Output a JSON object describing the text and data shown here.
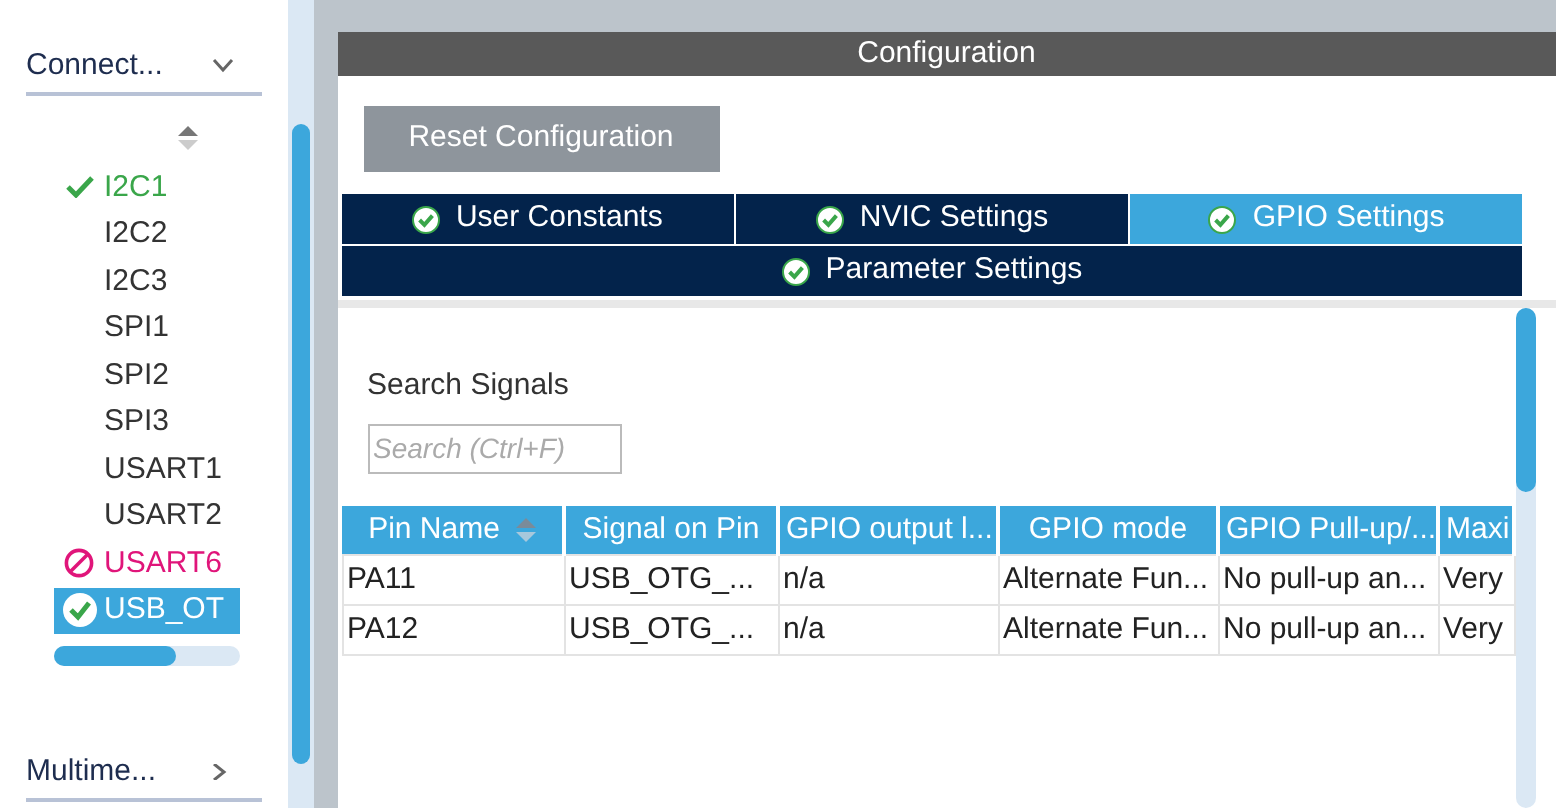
{
  "sidebar": {
    "category": {
      "label": "Connect...",
      "expanded": true
    },
    "items": [
      {
        "label": "I2C1",
        "kind": "configured",
        "selected": false
      },
      {
        "label": "I2C2",
        "kind": "plain",
        "selected": false
      },
      {
        "label": "I2C3",
        "kind": "plain",
        "selected": false
      },
      {
        "label": "SPI1",
        "kind": "plain",
        "selected": false
      },
      {
        "label": "SPI2",
        "kind": "plain",
        "selected": false
      },
      {
        "label": "SPI3",
        "kind": "plain",
        "selected": false
      },
      {
        "label": "USART1",
        "kind": "plain",
        "selected": false
      },
      {
        "label": "USART2",
        "kind": "plain",
        "selected": false
      },
      {
        "label": "USART6",
        "kind": "disabled",
        "selected": false
      },
      {
        "label": "USB_OT",
        "kind": "configured",
        "selected": true
      }
    ],
    "next_category": {
      "label": "Multime...",
      "expanded": false
    }
  },
  "panel": {
    "title": "Configuration",
    "reset_button": "Reset Configuration",
    "tabs": [
      {
        "label": "User Constants",
        "selected": false
      },
      {
        "label": "NVIC Settings",
        "selected": false
      },
      {
        "label": "GPIO Settings",
        "selected": true
      },
      {
        "label": "Parameter Settings",
        "selected": false
      }
    ],
    "search": {
      "label": "Search Signals",
      "placeholder": "Search (Ctrl+F)"
    },
    "table": {
      "columns": [
        "Pin Name",
        "Signal on Pin",
        "GPIO output l...",
        "GPIO mode",
        "GPIO Pull-up/...",
        "Maxi"
      ],
      "rows": [
        [
          "PA11",
          "USB_OTG_...",
          "n/a",
          "Alternate Fun...",
          "No pull-up an...",
          "Very"
        ],
        [
          "PA12",
          "USB_OTG_...",
          "n/a",
          "Alternate Fun...",
          "No pull-up an...",
          "Very"
        ]
      ]
    }
  }
}
